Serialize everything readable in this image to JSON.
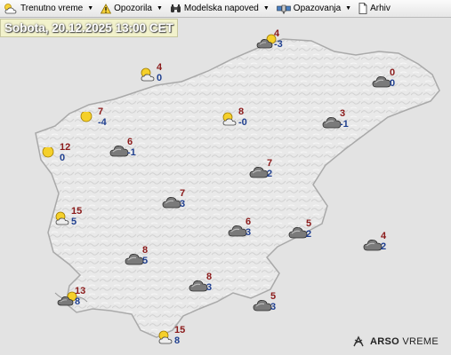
{
  "nav": {
    "items": [
      {
        "label": "Trenutno vreme",
        "icon": "cloud-sun-icon"
      },
      {
        "label": "Opozorila",
        "icon": "warning-icon"
      },
      {
        "label": "Modelska napoved",
        "icon": "binoculars-icon"
      },
      {
        "label": "Opazovanja",
        "icon": "satellite-icon"
      },
      {
        "label": "Arhiv",
        "icon": "document-icon"
      }
    ]
  },
  "title": "Sobota, 20.12.2025 13:00 CET",
  "logo": {
    "brand": "ARSO",
    "name": "VREME"
  },
  "stations": [
    {
      "icon": "partly-cloudy",
      "max": "4",
      "min": "-3"
    },
    {
      "icon": "partly-cloudy",
      "max": "4",
      "min": "0"
    },
    {
      "icon": "overcast",
      "max": "0",
      "min": "0"
    },
    {
      "icon": "sunny",
      "max": "7",
      "min": "-4"
    },
    {
      "icon": "partly-cloudy",
      "max": "8",
      "min": "-0"
    },
    {
      "icon": "overcast",
      "max": "3",
      "min": "-1"
    },
    {
      "icon": "sunny",
      "max": "12",
      "min": "0"
    },
    {
      "icon": "overcast",
      "max": "6",
      "min": "-1"
    },
    {
      "icon": "overcast",
      "max": "7",
      "min": "2"
    },
    {
      "icon": "overcast",
      "max": "7",
      "min": "3"
    },
    {
      "icon": "partly-cloudy",
      "max": "15",
      "min": "5"
    },
    {
      "icon": "overcast",
      "max": "6",
      "min": "3"
    },
    {
      "icon": "overcast",
      "max": "5",
      "min": "2"
    },
    {
      "icon": "overcast",
      "max": "4",
      "min": "2"
    },
    {
      "icon": "overcast",
      "max": "8",
      "min": "5"
    },
    {
      "icon": "partly-cloudy",
      "max": "13",
      "min": "8"
    },
    {
      "icon": "overcast",
      "max": "8",
      "min": "3"
    },
    {
      "icon": "overcast",
      "max": "5",
      "min": "3"
    },
    {
      "icon": "partly-cloudy",
      "max": "15",
      "min": "8"
    }
  ]
}
